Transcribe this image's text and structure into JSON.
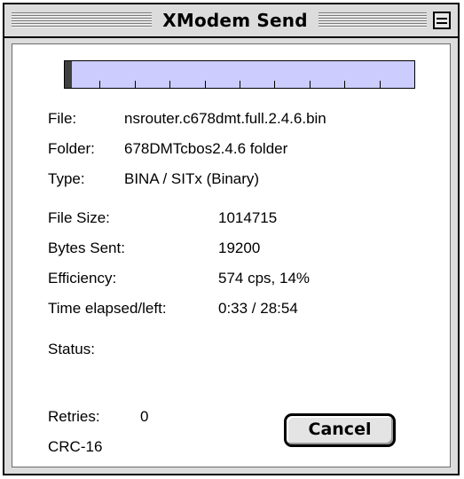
{
  "window": {
    "title": "XModem Send"
  },
  "progress": {
    "fraction": 0.02
  },
  "file_info": {
    "file_label": "File:",
    "file_value": "nsrouter.c678dmt.full.2.4.6.bin",
    "folder_label": "Folder:",
    "folder_value": "678DMTcbos2.4.6 folder",
    "type_label": "Type:",
    "type_value": "BINA / SITx (Binary)"
  },
  "stats": {
    "file_size_label": "File Size:",
    "file_size_value": "1014715",
    "bytes_sent_label": "Bytes Sent:",
    "bytes_sent_value": "19200",
    "efficiency_label": "Efficiency:",
    "efficiency_value": "574 cps, 14%",
    "time_label": "Time elapsed/left:",
    "time_value": "0:33 / 28:54"
  },
  "status": {
    "label": "Status:",
    "value": ""
  },
  "footer": {
    "retries_label": "Retries:",
    "retries_value": "0",
    "crc_label": "CRC-16",
    "cancel_label": "Cancel"
  },
  "colors": {
    "progress_track": "#ccccff",
    "progress_fill": "#404040",
    "window_frame": "#dcdcdc"
  }
}
